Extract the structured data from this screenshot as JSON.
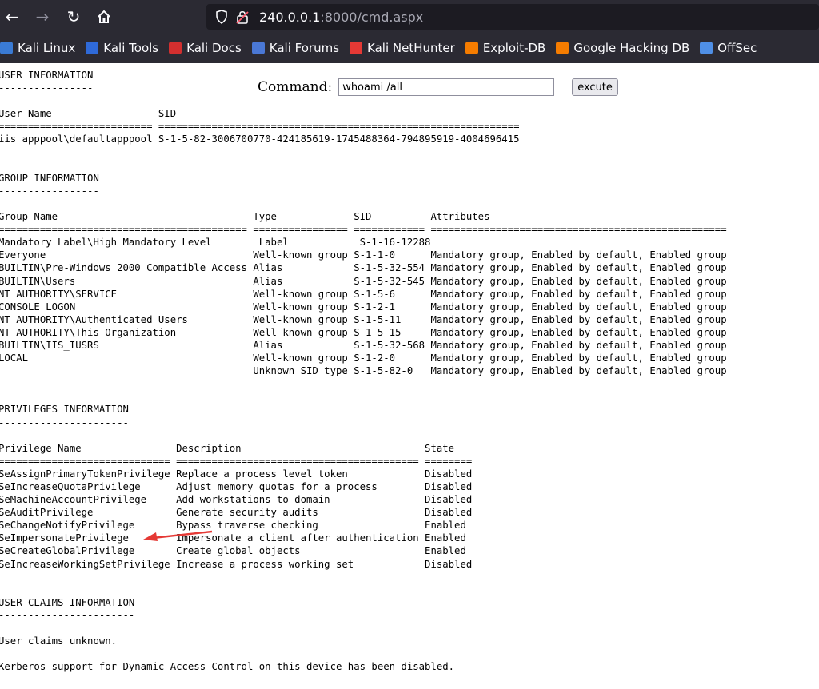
{
  "browser": {
    "url_host": "240.0.0.1",
    "url_rest": ":8000/cmd.aspx",
    "bookmarks": [
      {
        "label": "Kali Linux",
        "icon": "kali-dragon-icon",
        "color": "#3a7bd5"
      },
      {
        "label": "Kali Tools",
        "icon": "kali-tools-icon",
        "color": "#2f6ad9"
      },
      {
        "label": "Kali Docs",
        "icon": "kali-docs-icon",
        "color": "#d32f2f"
      },
      {
        "label": "Kali Forums",
        "icon": "kali-forums-icon",
        "color": "#4a78d6"
      },
      {
        "label": "Kali NetHunter",
        "icon": "kali-nethunter-icon",
        "color": "#e53935"
      },
      {
        "label": "Exploit-DB",
        "icon": "exploit-db-icon",
        "color": "#f57c00"
      },
      {
        "label": "Google Hacking DB",
        "icon": "ghdb-icon",
        "color": "#f57c00"
      },
      {
        "label": "OffSec",
        "icon": "offsec-icon",
        "color": "#4f8fe6"
      }
    ]
  },
  "form": {
    "label": "Command:",
    "value": "whoami /all",
    "button": "excute"
  },
  "output": {
    "text": "USER INFORMATION\n----------------\n\nUser Name                  SID\n========================== =============================================================\niis apppool\\defaultapppool S-1-5-82-3006700770-424185619-1745488364-794895919-4004696415\n\n\nGROUP INFORMATION\n-----------------\n\nGroup Name                                 Type             SID          Attributes\n========================================== ================ ============ ==================================================\nMandatory Label\\High Mandatory Level        Label            S-1-16-12288\nEveryone                                   Well-known group S-1-1-0      Mandatory group, Enabled by default, Enabled group\nBUILTIN\\Pre-Windows 2000 Compatible Access Alias            S-1-5-32-554 Mandatory group, Enabled by default, Enabled group\nBUILTIN\\Users                              Alias            S-1-5-32-545 Mandatory group, Enabled by default, Enabled group\nNT AUTHORITY\\SERVICE                       Well-known group S-1-5-6      Mandatory group, Enabled by default, Enabled group\nCONSOLE LOGON                              Well-known group S-1-2-1      Mandatory group, Enabled by default, Enabled group\nNT AUTHORITY\\Authenticated Users           Well-known group S-1-5-11     Mandatory group, Enabled by default, Enabled group\nNT AUTHORITY\\This Organization             Well-known group S-1-5-15     Mandatory group, Enabled by default, Enabled group\nBUILTIN\\IIS_IUSRS                          Alias            S-1-5-32-568 Mandatory group, Enabled by default, Enabled group\nLOCAL                                      Well-known group S-1-2-0      Mandatory group, Enabled by default, Enabled group\n                                           Unknown SID type S-1-5-82-0   Mandatory group, Enabled by default, Enabled group\n\n\nPRIVILEGES INFORMATION\n----------------------\n\nPrivilege Name                Description                               State\n============================= ========================================= ========\nSeAssignPrimaryTokenPrivilege Replace a process level token             Disabled\nSeIncreaseQuotaPrivilege      Adjust memory quotas for a process        Disabled\nSeMachineAccountPrivilege     Add workstations to domain                Disabled\nSeAuditPrivilege              Generate security audits                  Disabled\nSeChangeNotifyPrivilege       Bypass traverse checking                  Enabled\nSeImpersonatePrivilege        Impersonate a client after authentication Enabled\nSeCreateGlobalPrivilege       Create global objects                     Enabled\nSeIncreaseWorkingSetPrivilege Increase a process working set            Disabled\n\n\nUSER CLAIMS INFORMATION\n-----------------------\n\nUser claims unknown.\n\nKerberos support for Dynamic Access Control on this device has been disabled."
  },
  "annotation": {
    "color": "#e53935",
    "icon": "red-arrow-icon"
  }
}
